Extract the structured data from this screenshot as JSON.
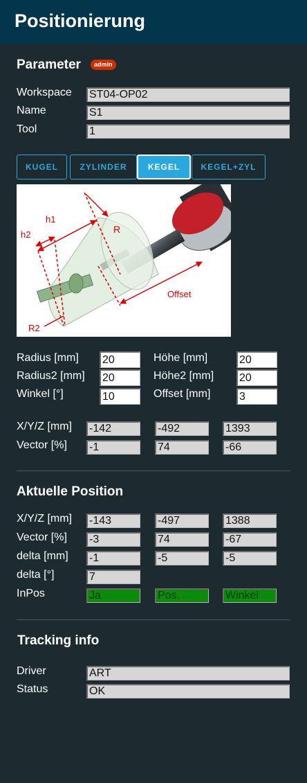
{
  "header": {
    "title": "Positionierung"
  },
  "parameter": {
    "title": "Parameter",
    "badge": "admin",
    "workspace_label": "Workspace",
    "workspace_value": "ST04-OP02",
    "name_label": "Name",
    "name_value": "S1",
    "tool_label": "Tool",
    "tool_value": "1"
  },
  "tabs": [
    {
      "label": "KUGEL",
      "active": false
    },
    {
      "label": "ZYLINDER",
      "active": false
    },
    {
      "label": "KEGEL",
      "active": true
    },
    {
      "label": "KEGEL+ZYL",
      "active": false
    }
  ],
  "diagram": {
    "labels": {
      "h1": "h1",
      "h2": "h2",
      "r": "R",
      "r2": "R2",
      "offset": "Offset"
    },
    "accent_color": "#e00000"
  },
  "dims": {
    "radius_label": "Radius [mm]",
    "radius_value": "20",
    "radius2_label": "Radius2 [mm]",
    "radius2_value": "20",
    "winkel_label": "Winkel [°]",
    "winkel_value": "10",
    "hoehe_label": "Höhe [mm]",
    "hoehe_value": "20",
    "hoehe2_label": "Höhe2 [mm]",
    "hoehe2_value": "20",
    "offset_label": "Offset [mm]",
    "offset_value": "3"
  },
  "target": {
    "xyz_label": "X/Y/Z [mm]",
    "xyz": [
      "-142",
      "-492",
      "1393"
    ],
    "vector_label": "Vector [%]",
    "vector": [
      "-1",
      "74",
      "-66"
    ]
  },
  "actual": {
    "title": "Aktuelle Position",
    "xyz_label": "X/Y/Z [mm]",
    "xyz": [
      "-143",
      "-497",
      "1388"
    ],
    "vector_label": "Vector [%]",
    "vector": [
      "-3",
      "74",
      "-67"
    ],
    "delta_mm_label": "delta [mm]",
    "delta_mm": [
      "-1",
      "-5",
      "-5"
    ],
    "delta_deg_label": "delta [°]",
    "delta_deg": "7",
    "inpos_label": "InPos",
    "inpos": [
      "Ja",
      "Pos.",
      "Winkel"
    ],
    "inpos_color": "#0c8a0c"
  },
  "tracking": {
    "title": "Tracking info",
    "driver_label": "Driver",
    "driver_value": "ART",
    "status_label": "Status",
    "status_value": "OK"
  }
}
